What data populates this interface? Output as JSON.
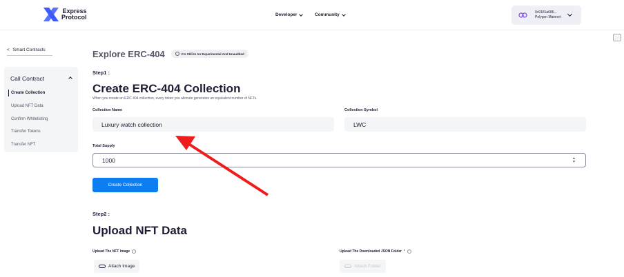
{
  "brand": {
    "name_line1": "Express",
    "name_line2": "Protocol"
  },
  "nav": {
    "developer": "Developer",
    "community": "Community"
  },
  "wallet": {
    "address": "0x9181a686...",
    "network": "Polygon Mainnet"
  },
  "sidebar": {
    "back_label": "Smart Contracts",
    "section_title": "Call Contract",
    "items": [
      {
        "label": "Create Collection",
        "active": true
      },
      {
        "label": "Upload NFT Data",
        "active": false
      },
      {
        "label": "Confirm Whitelisting",
        "active": false
      },
      {
        "label": "Transfer Tokens",
        "active": false
      },
      {
        "label": "Transfer NFT",
        "active": false
      }
    ]
  },
  "main": {
    "title": "Explore ERC-404",
    "badge": "It's Still In An Experimental And Unaudited",
    "step1": {
      "step_label": "Step1 :",
      "heading": "Create ERC-404 Collection",
      "description": "When you create an ERC 404 collection, every token you allocate generates an equivalent number of NFTs.",
      "collection_name_label": "Collection Name",
      "collection_name_value": "Luxury watch collection",
      "collection_symbol_label": "Collection Symbol",
      "collection_symbol_value": "LWC",
      "total_supply_label": "Total Supply",
      "total_supply_value": "1000",
      "create_button": "Create Collection"
    },
    "step2": {
      "step_label": "Step2 :",
      "heading": "Upload NFT Data",
      "upload_image_label": "Upload The NFT Image",
      "attach_image_button": "Attach Image",
      "upload_json_label": "Upload The Downloaded JSON Folder",
      "required_mark": "*",
      "attach_folder_button": "Attach Folder"
    }
  },
  "colors": {
    "primary": "#0c7ef2",
    "text": "#1d1d35",
    "field_bg": "#f4f5f7",
    "annotation_arrow": "#ee1c1c"
  }
}
